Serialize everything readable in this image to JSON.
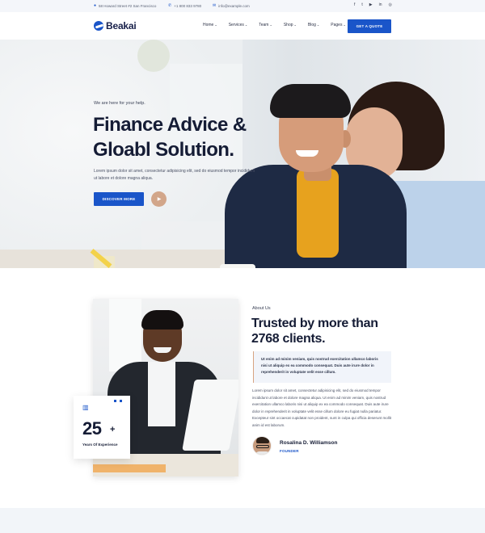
{
  "topbar": {
    "address": "58 Howard Street #2 San Francisco",
    "phone": "+1 800 833 9780",
    "email": "info@example.com",
    "socials": [
      "facebook-icon",
      "twitter-icon",
      "youtube-icon",
      "linkedin-icon",
      "instagram-icon"
    ]
  },
  "header": {
    "logo": "Beakai",
    "nav": [
      {
        "label": "Home"
      },
      {
        "label": "Services"
      },
      {
        "label": "Team"
      },
      {
        "label": "Shop"
      },
      {
        "label": "Blog"
      },
      {
        "label": "Pages"
      }
    ],
    "cta": "GET A QUOTE"
  },
  "hero": {
    "subtitle": "We are here for your help.",
    "title_line1": "Finance Advice &",
    "title_line2": "Gloabl Solution.",
    "text": "Lorem ipsum dolor sit amet, consectetur adipisicing elit, sed do eiusmod tempor incididunt ut labore et dolore magna aliqua.",
    "button": "DISCOVER MORE",
    "play_icon": "play-icon"
  },
  "about": {
    "label": "About Us",
    "title": "Trusted by more than 2768 clients.",
    "quote": "Ut enim ad minim veniam, quis nostrud exercitation ullamco laboris nisi ut aliquip ex ea commodo consequat. Duis aute irure dolor in reprehenderit in voluptate velit esse cillum.",
    "text": "Lorem ipsum dolor sit amet, consectetur adipisicing elit, sed do eiusmod tempor incididunt ut labore et dolore magna aliqua. Ut enim ad minim veniam, quis nostrud exercitation ullamco laboris nisi ut aliquip ex ea commodo consequat. Duis aute irure dolor in reprehenderit in voluptate velit esse cillum dolore eu fugiat nulla pariatur. Excepteur sint occaecat cupidatat non proident, sunt in culpa qui officia deserunt mollit anim id est laborum.",
    "stat_number": "25",
    "stat_plus": "+",
    "stat_label": "Years Of Experience",
    "author_name": "Rosalina D. Williamson",
    "author_role": "FOUNDER"
  },
  "colors": {
    "accent": "#1a55c9",
    "heading": "#151c35",
    "quote_border": "#d7a482"
  }
}
